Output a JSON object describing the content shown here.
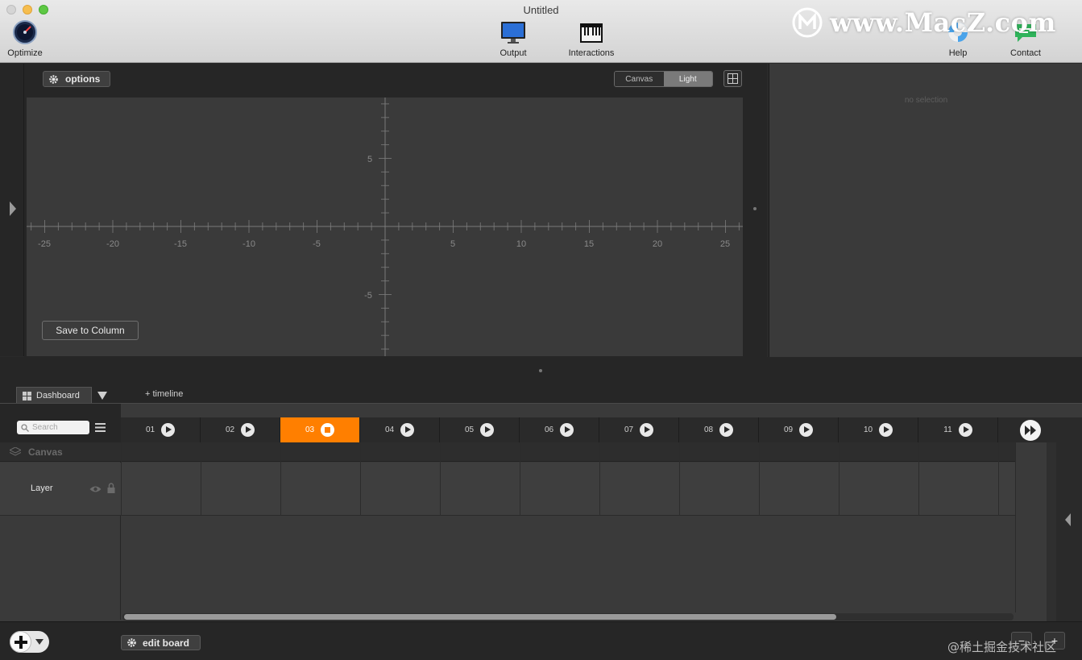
{
  "window": {
    "title": "Untitled"
  },
  "toolbar": {
    "optimize_label": "Optimize",
    "output_label": "Output",
    "interactions_label": "Interactions",
    "help_label": "Help",
    "contact_label": "Contact"
  },
  "watermark": {
    "text": "www.MacZ.com"
  },
  "canvas": {
    "options_label": "options",
    "view_modes": [
      "Canvas",
      "Light"
    ],
    "selected_view_mode": "Light",
    "save_button_label": "Save to Column",
    "x_tick_labels": [
      "-25",
      "-20",
      "-15",
      "-10",
      "-5",
      "5",
      "10",
      "15",
      "20",
      "25"
    ],
    "y_tick_labels": [
      "5",
      "-5"
    ]
  },
  "inspector": {
    "empty_text": "no selection"
  },
  "dashboard": {
    "tab_label": "Dashboard",
    "add_timeline_label": "+ timeline"
  },
  "timeline": {
    "search_placeholder": "Search",
    "columns": [
      {
        "label": "01",
        "state": "play"
      },
      {
        "label": "02",
        "state": "play"
      },
      {
        "label": "03",
        "state": "stop"
      },
      {
        "label": "04",
        "state": "play"
      },
      {
        "label": "05",
        "state": "play"
      },
      {
        "label": "06",
        "state": "play"
      },
      {
        "label": "07",
        "state": "play"
      },
      {
        "label": "08",
        "state": "play"
      },
      {
        "label": "09",
        "state": "play"
      },
      {
        "label": "10",
        "state": "play"
      },
      {
        "label": "11",
        "state": "play"
      }
    ],
    "active_column": "03",
    "canvas_group_label": "Canvas",
    "layer_label": "Layer"
  },
  "bottom": {
    "edit_board_label": "edit board"
  },
  "footer": {
    "credit": "@稀土掘金技术社区"
  },
  "colors": {
    "accent": "#ff7f00",
    "panel": "#3a3a3a",
    "dark": "#262626"
  }
}
